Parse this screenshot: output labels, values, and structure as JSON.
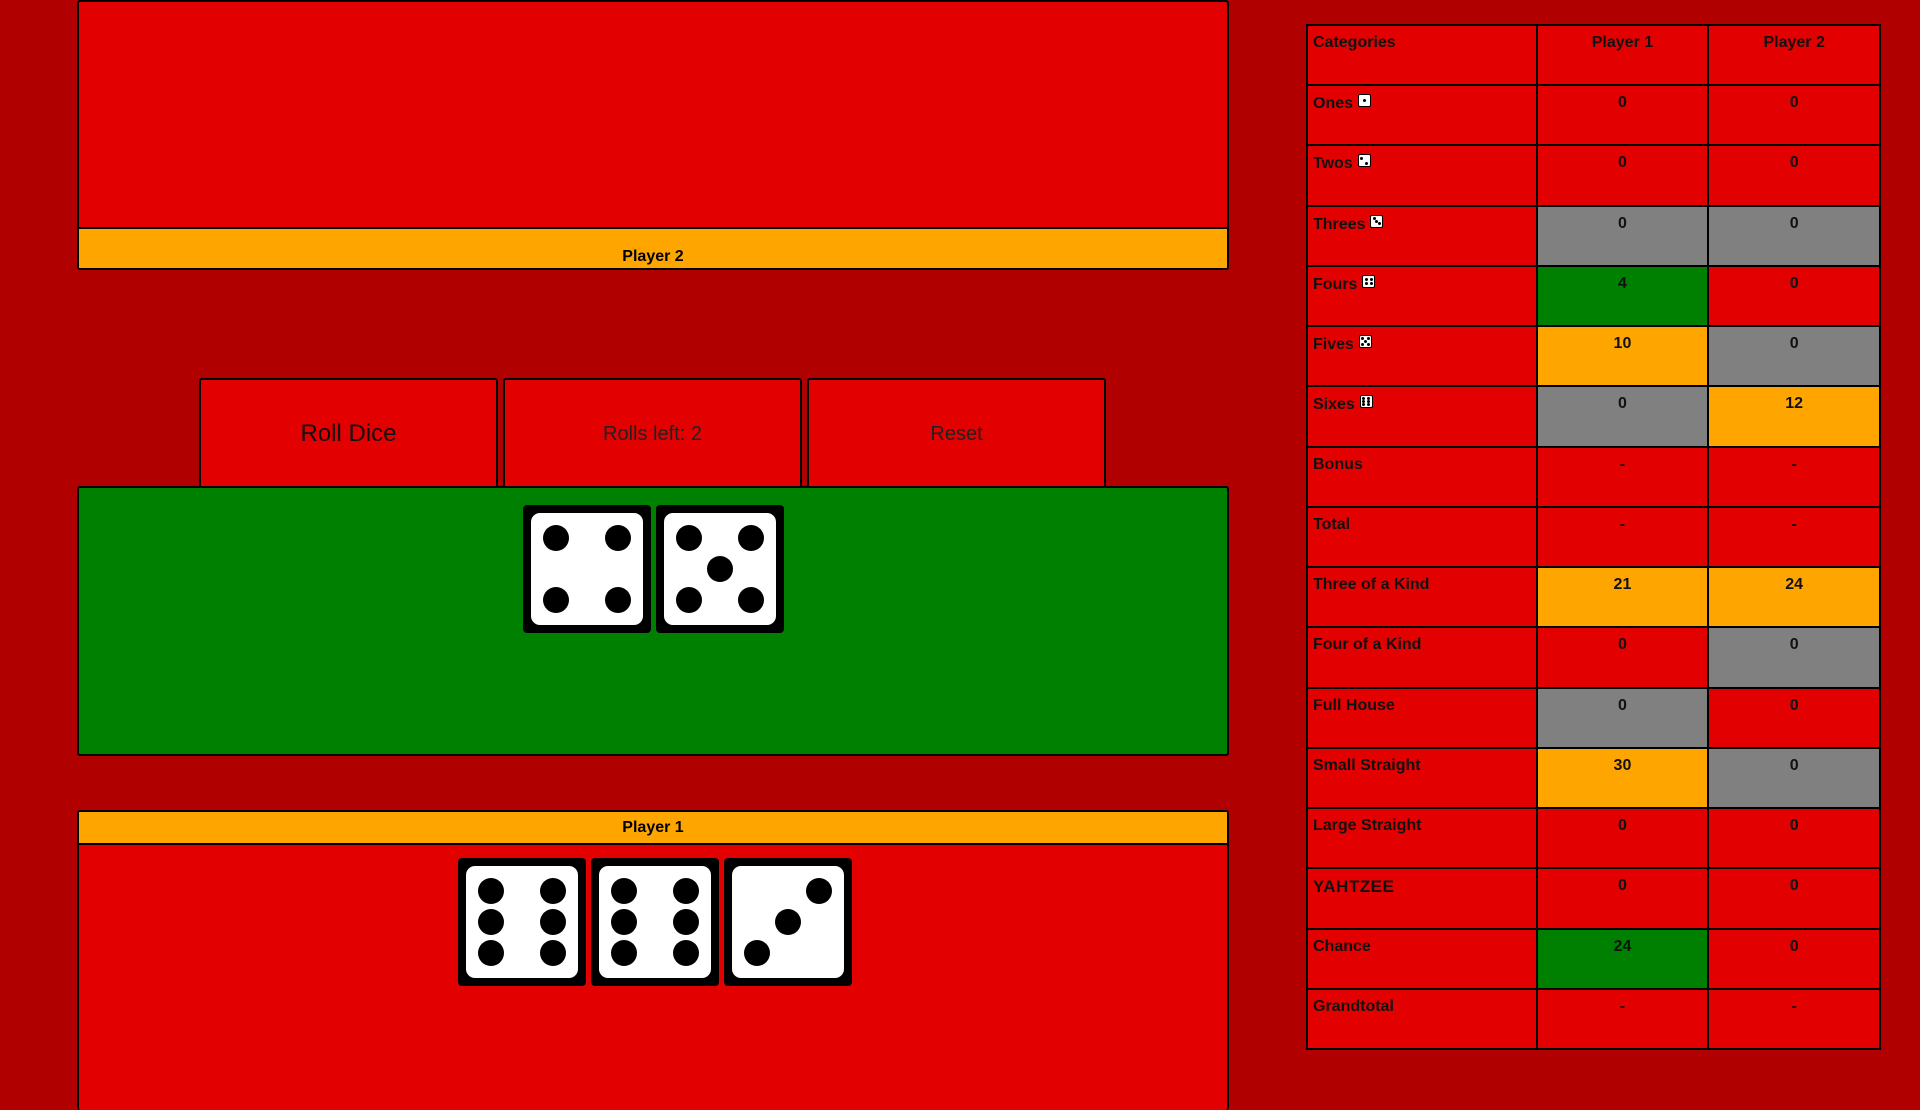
{
  "top_area": {
    "player_label": "Player 2",
    "dice": []
  },
  "controls": {
    "roll": "Roll Dice",
    "rolls_left": "Rolls left: 2",
    "reset": "Reset"
  },
  "board": {
    "dice": [
      4,
      5
    ]
  },
  "bottom_area": {
    "player_label": "Player 1",
    "dice": [
      6,
      6,
      3
    ]
  },
  "colors": {
    "background": "#b00000",
    "panel": "#e30000",
    "board": "#008000",
    "highlight_orange": "#ffa500",
    "highlight_green": "#008000",
    "highlight_gray": "#808080"
  },
  "scorecard": {
    "headers": [
      "Categories",
      "Player 1",
      "Player 2"
    ],
    "rows": [
      {
        "category": "Ones",
        "icon": "die-one-icon",
        "p1": "0",
        "p2": "0",
        "p1_state": "normal",
        "p2_state": "normal"
      },
      {
        "category": "Twos",
        "icon": "die-two-icon",
        "p1": "0",
        "p2": "0",
        "p1_state": "normal",
        "p2_state": "normal"
      },
      {
        "category": "Threes",
        "icon": "die-three-icon",
        "p1": "0",
        "p2": "0",
        "p1_state": "gray",
        "p2_state": "gray"
      },
      {
        "category": "Fours",
        "icon": "die-four-icon",
        "p1": "4",
        "p2": "0",
        "p1_state": "green",
        "p2_state": "normal"
      },
      {
        "category": "Fives",
        "icon": "die-five-icon",
        "p1": "10",
        "p2": "0",
        "p1_state": "orange",
        "p2_state": "gray"
      },
      {
        "category": "Sixes",
        "icon": "die-six-icon",
        "p1": "0",
        "p2": "12",
        "p1_state": "gray",
        "p2_state": "orange"
      },
      {
        "category": "Bonus",
        "icon": "",
        "p1": "-",
        "p2": "-",
        "p1_state": "normal",
        "p2_state": "normal"
      },
      {
        "category": "Total",
        "icon": "",
        "p1": "-",
        "p2": "-",
        "p1_state": "normal",
        "p2_state": "normal"
      },
      {
        "category": "Three of a Kind",
        "icon": "",
        "p1": "21",
        "p2": "24",
        "p1_state": "orange",
        "p2_state": "orange"
      },
      {
        "category": "Four of a Kind",
        "icon": "",
        "p1": "0",
        "p2": "0",
        "p1_state": "normal",
        "p2_state": "gray"
      },
      {
        "category": "Full House",
        "icon": "",
        "p1": "0",
        "p2": "0",
        "p1_state": "gray",
        "p2_state": "normal"
      },
      {
        "category": "Small Straight",
        "icon": "",
        "p1": "30",
        "p2": "0",
        "p1_state": "orange",
        "p2_state": "gray"
      },
      {
        "category": "Large Straight",
        "icon": "",
        "p1": "0",
        "p2": "0",
        "p1_state": "normal",
        "p2_state": "normal"
      },
      {
        "category": "YAHTZEE",
        "icon": "",
        "p1": "0",
        "p2": "0",
        "p1_state": "normal",
        "p2_state": "normal"
      },
      {
        "category": "Chance",
        "icon": "",
        "p1": "24",
        "p2": "0",
        "p1_state": "green",
        "p2_state": "normal"
      },
      {
        "category": "Grandtotal",
        "icon": "",
        "p1": "-",
        "p2": "-",
        "p1_state": "normal",
        "p2_state": "normal"
      }
    ]
  }
}
